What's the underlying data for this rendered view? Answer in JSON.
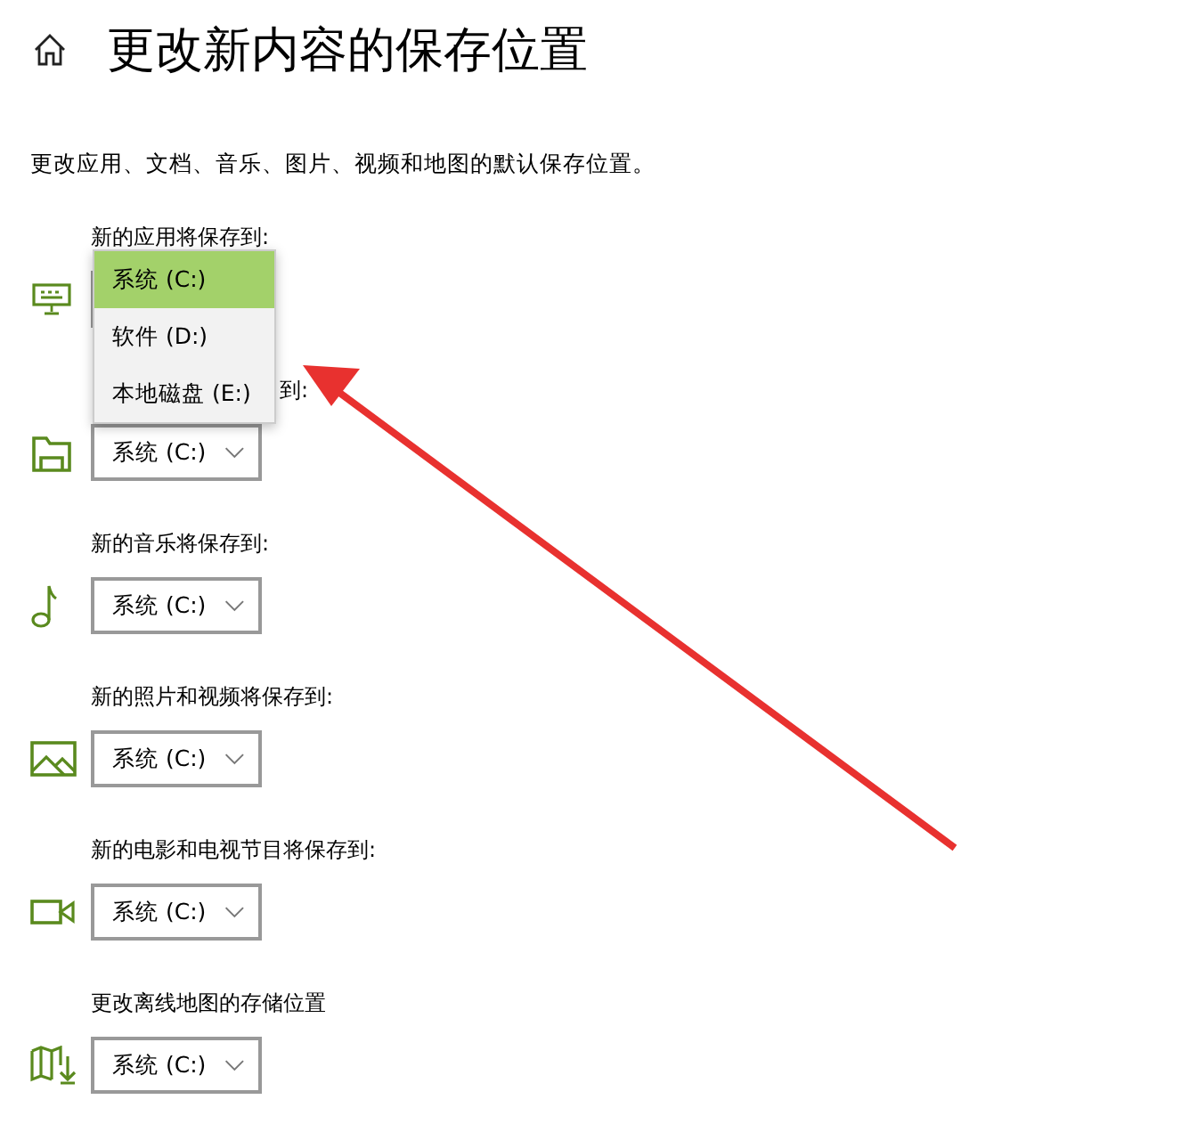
{
  "page": {
    "title": "更改新内容的保存位置",
    "description": "更改应用、文档、音乐、图片、视频和地图的默认保存位置。"
  },
  "sections": [
    {
      "label": "新的应用将保存到:"
    },
    {
      "label": "到:",
      "value": "系统 (C:)"
    },
    {
      "label": "新的音乐将保存到:",
      "value": "系统 (C:)"
    },
    {
      "label": "新的照片和视频将保存到:",
      "value": "系统 (C:)"
    },
    {
      "label": "新的电影和电视节目将保存到:",
      "value": "系统 (C:)"
    },
    {
      "label": "更改离线地图的存储位置",
      "value": "系统 (C:)"
    }
  ],
  "menu_options": [
    {
      "label": "系统 (C:)",
      "selected": true
    },
    {
      "label": "软件 (D:)",
      "selected": false
    },
    {
      "label": "本地磁盘 (E:)",
      "selected": false
    }
  ]
}
